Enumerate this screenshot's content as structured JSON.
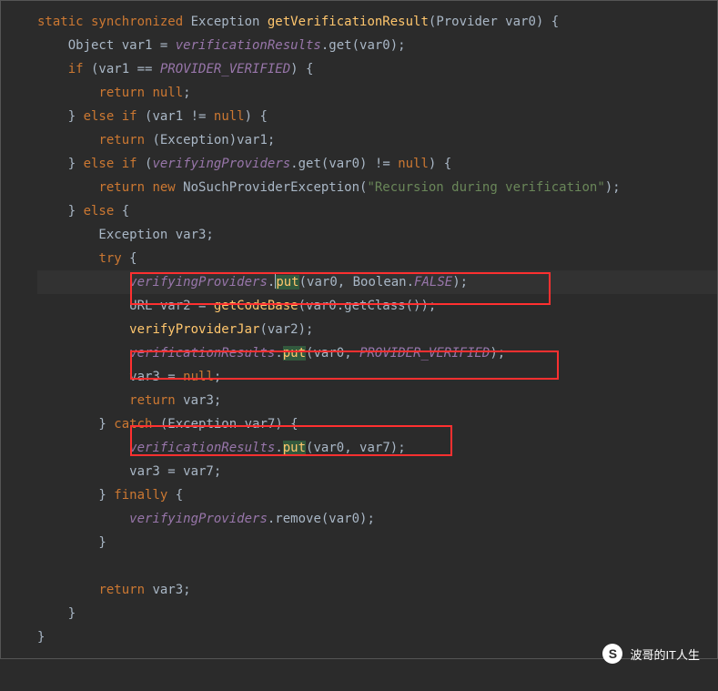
{
  "code": {
    "l1_kw1": "static synchronized",
    "l1_type": " Exception ",
    "l1_method": "getVerificationResult",
    "l1_rest": "(Provider var0) {",
    "l2_a": "    Object var1 = ",
    "l2_field": "verificationResults",
    "l2_b": ".get(var0);",
    "l3_a": "    ",
    "l3_kw": "if",
    "l3_b": " (var1 == ",
    "l3_const": "PROVIDER_VERIFIED",
    "l3_c": ") {",
    "l4_a": "        ",
    "l4_kw": "return null",
    "l4_b": ";",
    "l5_a": "    } ",
    "l5_kw1": "else if",
    "l5_b": " (var1 != ",
    "l5_kw2": "null",
    "l5_c": ") {",
    "l6_a": "        ",
    "l6_kw": "return",
    "l6_b": " (Exception)var1;",
    "l7_a": "    } ",
    "l7_kw1": "else if",
    "l7_b": " (",
    "l7_field": "verifyingProviders",
    "l7_c": ".get(var0) != ",
    "l7_kw2": "null",
    "l7_d": ") {",
    "l8_a": "        ",
    "l8_kw": "return new",
    "l8_b": " NoSuchProviderException(",
    "l8_str": "\"Recursion during verification\"",
    "l8_c": ");",
    "l9_a": "    } ",
    "l9_kw": "else",
    "l9_b": " {",
    "l10": "        Exception var3;",
    "l11_a": "        ",
    "l11_kw": "try",
    "l11_b": " {",
    "l12_a": "            ",
    "l12_field": "verifyingProviders",
    "l12_b": ".",
    "l12_put": "put",
    "l12_c": "(var0, Boolean.",
    "l12_const": "FALSE",
    "l12_d": ");",
    "l13_a": "            URL var2 = ",
    "l13_m": "getCodeBase",
    "l13_b": "(var0.getClass());",
    "l14_a": "            ",
    "l14_m": "verifyProviderJar",
    "l14_b": "(var2);",
    "l15_a": "            ",
    "l15_field": "verificationResults",
    "l15_b": ".",
    "l15_put": "put",
    "l15_c": "(var0, ",
    "l15_const": "PROVIDER_VERIFIED",
    "l15_d": ");",
    "l16_a": "            var3 = ",
    "l16_kw": "null",
    "l16_b": ";",
    "l17_a": "            ",
    "l17_kw": "return",
    "l17_b": " var3;",
    "l18_a": "        } ",
    "l18_kw": "catch",
    "l18_b": " (Exception var7) {",
    "l19_a": "            ",
    "l19_field": "verificationResults",
    "l19_b": ".",
    "l19_put": "put",
    "l19_c": "(var0, var7);",
    "l20": "            var3 = var7;",
    "l21_a": "        } ",
    "l21_kw": "finally",
    "l21_b": " {",
    "l22_a": "            ",
    "l22_field": "verifyingProviders",
    "l22_b": ".remove(var0);",
    "l23": "        }",
    "l24_a": "        ",
    "l24_kw": "return",
    "l24_b": " var3;",
    "l25": "    }",
    "l26": "}"
  },
  "watermark": {
    "icon_text": "S",
    "text": "波哥的IT人生"
  }
}
